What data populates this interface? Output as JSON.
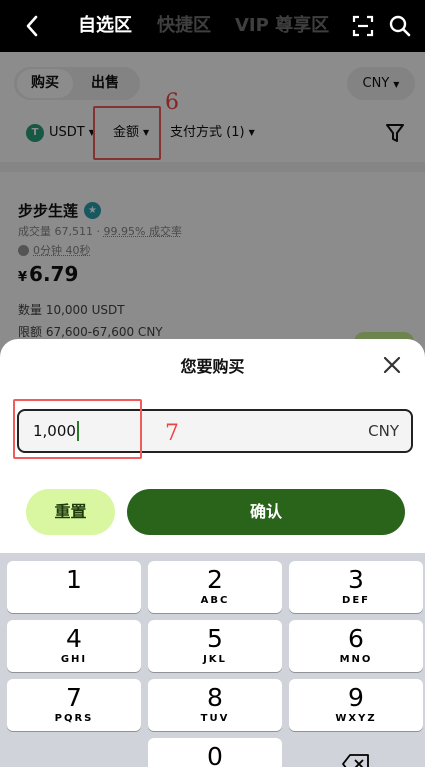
{
  "nav": {
    "tabs": [
      {
        "label": "自选区",
        "active": true
      },
      {
        "label": "快捷区",
        "active": false
      },
      {
        "label": "VIP 尊享区",
        "active": false
      }
    ]
  },
  "toolbar": {
    "buy_tab": "购买",
    "sell_tab": "出售",
    "currency": "CNY"
  },
  "filters": {
    "coin": "USDT",
    "amount": "金额",
    "payment": "支付方式 (1)"
  },
  "annotations": {
    "step6": "6",
    "step7": "7"
  },
  "offer": {
    "merchant": "步步生莲",
    "volume_label": "成交量 67,511",
    "completion_rate": "99.95% 成交率",
    "timer": "0分钟 40秒",
    "currency_symbol": "¥",
    "price": "6.79",
    "quantity": "数量 10,000 USDT",
    "limit": "限额 67,600-67,600 CNY"
  },
  "sheet": {
    "title": "您要购买",
    "amount_value": "1,000",
    "amount_currency": "CNY",
    "reset_label": "重置",
    "confirm_label": "确认"
  },
  "keypad": [
    {
      "digit": "1",
      "letters": ""
    },
    {
      "digit": "2",
      "letters": "ABC"
    },
    {
      "digit": "3",
      "letters": "DEF"
    },
    {
      "digit": "4",
      "letters": "GHI"
    },
    {
      "digit": "5",
      "letters": "JKL"
    },
    {
      "digit": "6",
      "letters": "MNO"
    },
    {
      "digit": "7",
      "letters": "PQRS"
    },
    {
      "digit": "8",
      "letters": "TUV"
    },
    {
      "digit": "9",
      "letters": "WXYZ"
    },
    {
      "digit": "0",
      "letters": ""
    }
  ],
  "colors": {
    "accent_green": "#2a641a",
    "light_green": "#d9f6a1",
    "annotation_red": "#f04444"
  }
}
